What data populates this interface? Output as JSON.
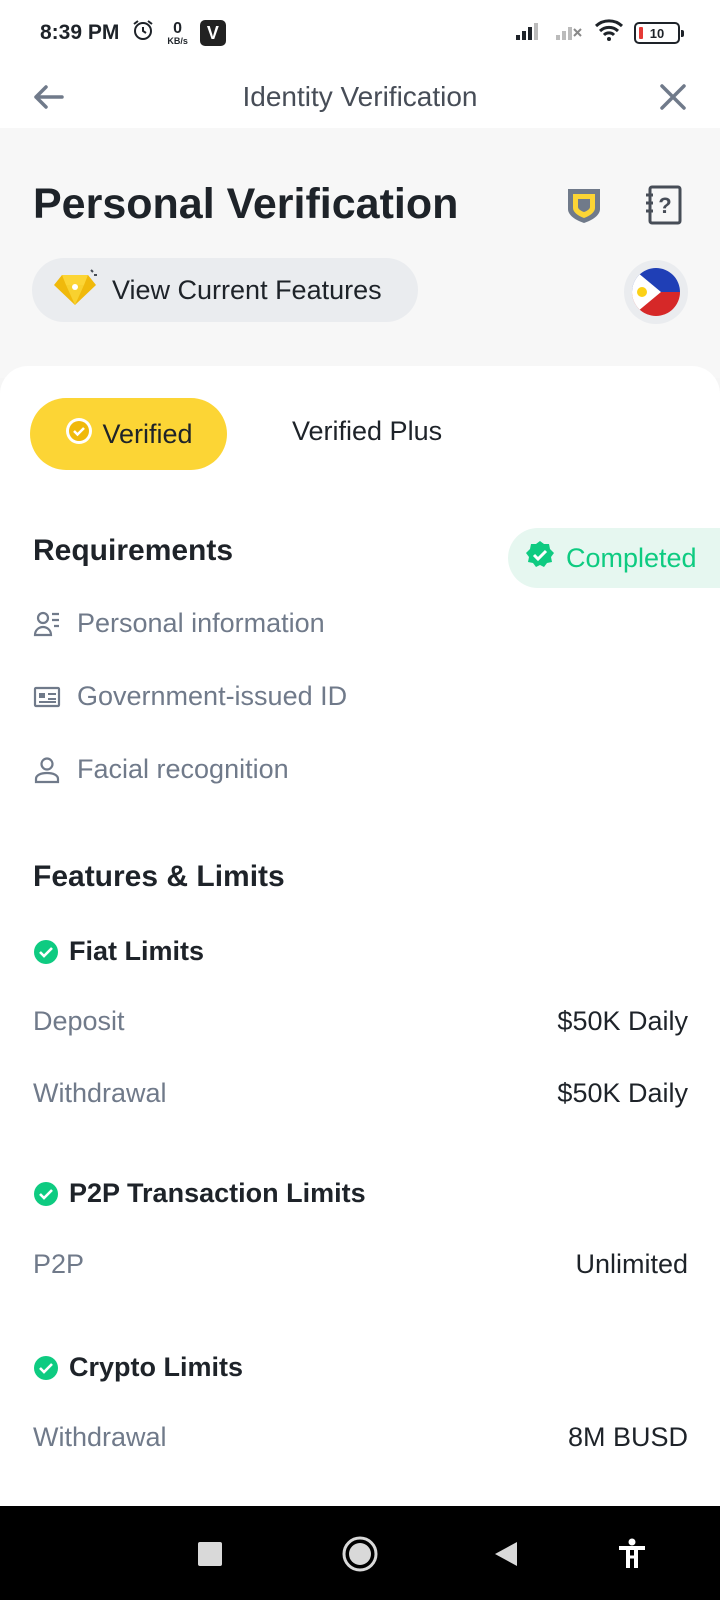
{
  "status_bar": {
    "time": "8:39 PM",
    "network_speed": "0",
    "network_unit": "KB/s",
    "app_badge": "V",
    "battery": "10"
  },
  "nav": {
    "title": "Identity Verification",
    "back_icon": "arrow-left-icon",
    "close_icon": "close-icon"
  },
  "header": {
    "title": "Personal Verification",
    "features_button": "View Current Features",
    "shield_icon": "shield-icon",
    "help_icon": "help-document-icon",
    "country_flag": "philippines-flag-icon"
  },
  "tabs": [
    {
      "label": "Verified",
      "active": true
    },
    {
      "label": "Verified Plus",
      "active": false
    }
  ],
  "requirements": {
    "title": "Requirements",
    "status": "Completed",
    "items": [
      {
        "label": "Personal information",
        "icon": "person-info-icon"
      },
      {
        "label": "Government-issued ID",
        "icon": "id-card-icon"
      },
      {
        "label": "Facial recognition",
        "icon": "person-icon"
      }
    ]
  },
  "features": {
    "title": "Features & Limits",
    "groups": [
      {
        "title": "Fiat Limits",
        "rows": [
          {
            "label": "Deposit",
            "value": "$50K Daily"
          },
          {
            "label": "Withdrawal",
            "value": "$50K Daily"
          }
        ]
      },
      {
        "title": "P2P Transaction Limits",
        "rows": [
          {
            "label": "P2P",
            "value": "Unlimited"
          }
        ]
      },
      {
        "title": "Crypto Limits",
        "rows": [
          {
            "label": "Withdrawal",
            "value": "8M BUSD"
          }
        ]
      }
    ]
  },
  "colors": {
    "accent": "#FCD535",
    "success": "#0ECB81",
    "text_primary": "#1E2329",
    "text_secondary": "#707A8A"
  }
}
